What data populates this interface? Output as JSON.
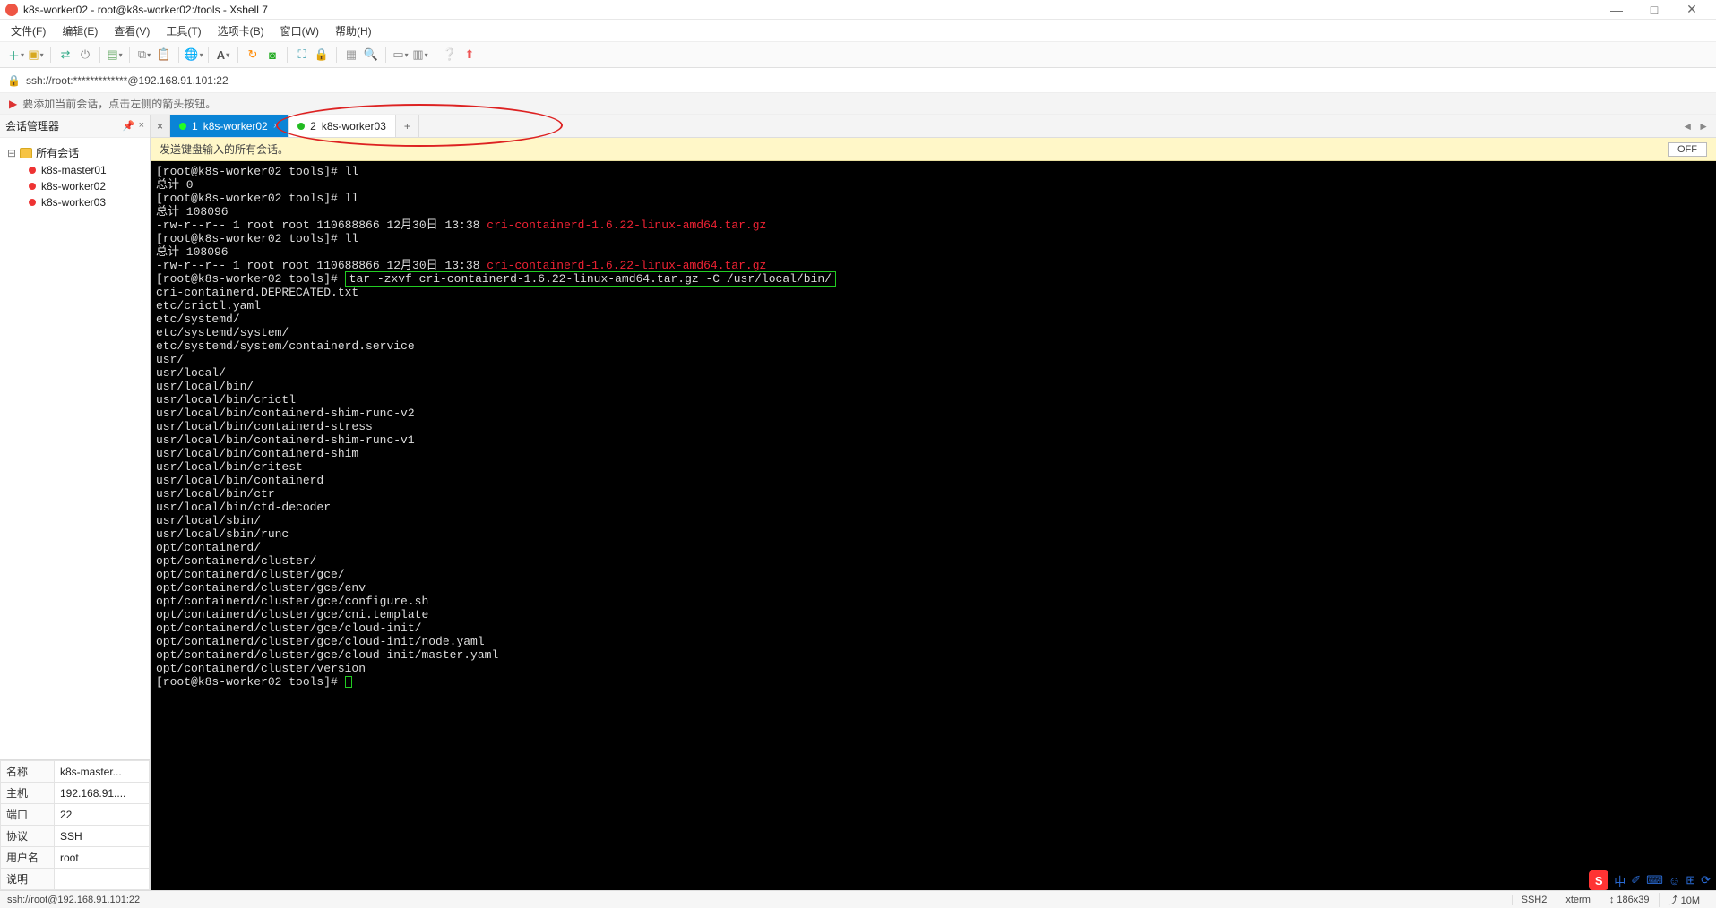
{
  "title": "k8s-worker02 - root@k8s-worker02:/tools - Xshell 7",
  "window_buttons": {
    "min": "—",
    "max": "□",
    "close": "✕"
  },
  "menu": [
    "文件(F)",
    "编辑(E)",
    "查看(V)",
    "工具(T)",
    "选项卡(B)",
    "窗口(W)",
    "帮助(H)"
  ],
  "address": "ssh://root:*************@192.168.91.101:22",
  "tip": "要添加当前会话，点击左侧的箭头按钮。",
  "sessmgr": {
    "title": "会话管理器",
    "pin": "📌",
    "x": "×"
  },
  "tree": {
    "root": "所有会话",
    "items": [
      "k8s-master01",
      "k8s-worker02",
      "k8s-worker03"
    ]
  },
  "props": [
    [
      "名称",
      "k8s-master..."
    ],
    [
      "主机",
      "192.168.91...."
    ],
    [
      "端口",
      "22"
    ],
    [
      "协议",
      "SSH"
    ],
    [
      "用户名",
      "root"
    ],
    [
      "说明",
      ""
    ]
  ],
  "tabs": [
    {
      "num": "1",
      "label": "k8s-worker02",
      "active": true
    },
    {
      "num": "2",
      "label": "k8s-worker03",
      "active": false
    }
  ],
  "tab_controls": {
    "closeall": "×",
    "add": "+",
    "left": "◄",
    "right": "►"
  },
  "broadcast": {
    "text": "发送键盘输入的所有会话。",
    "btn": "OFF"
  },
  "terminal": {
    "prompt": "[root@k8s-worker02 tools]# ",
    "filelist_file": "cri-containerd-1.6.22-linux-amd64.tar.gz",
    "lines_pre": [
      "[root@k8s-worker02 tools]# ll",
      "总计 0",
      "[root@k8s-worker02 tools]# ll",
      "总计 108096",
      "-rw-r--r-- 1 root root 110688866 12月30日 13:38 ",
      "[root@k8s-worker02 tools]# ll",
      "总计 108096",
      "-rw-r--r-- 1 root root 110688866 12月30日 13:38 "
    ],
    "highlight_cmd": "tar -zxvf cri-containerd-1.6.22-linux-amd64.tar.gz -C /usr/local/bin/",
    "lines_post": [
      "cri-containerd.DEPRECATED.txt",
      "etc/crictl.yaml",
      "etc/systemd/",
      "etc/systemd/system/",
      "etc/systemd/system/containerd.service",
      "usr/",
      "usr/local/",
      "usr/local/bin/",
      "usr/local/bin/crictl",
      "usr/local/bin/containerd-shim-runc-v2",
      "usr/local/bin/containerd-stress",
      "usr/local/bin/containerd-shim-runc-v1",
      "usr/local/bin/containerd-shim",
      "usr/local/bin/critest",
      "usr/local/bin/containerd",
      "usr/local/bin/ctr",
      "usr/local/bin/ctd-decoder",
      "usr/local/sbin/",
      "usr/local/sbin/runc",
      "opt/containerd/",
      "opt/containerd/cluster/",
      "opt/containerd/cluster/gce/",
      "opt/containerd/cluster/gce/env",
      "opt/containerd/cluster/gce/configure.sh",
      "opt/containerd/cluster/gce/cni.template",
      "opt/containerd/cluster/gce/cloud-init/",
      "opt/containerd/cluster/gce/cloud-init/node.yaml",
      "opt/containerd/cluster/gce/cloud-init/master.yaml",
      "opt/containerd/cluster/version"
    ]
  },
  "status": {
    "left": "ssh://root@192.168.91.101:22",
    "proto": "SSH2",
    "term": "xterm",
    "size": "↕ 186x39",
    "extras": "⤴ 10M"
  },
  "ime": {
    "s": "S",
    "zh": "中",
    "items": [
      "✐",
      "⌨",
      "☺",
      "⊞",
      "⟳"
    ]
  }
}
